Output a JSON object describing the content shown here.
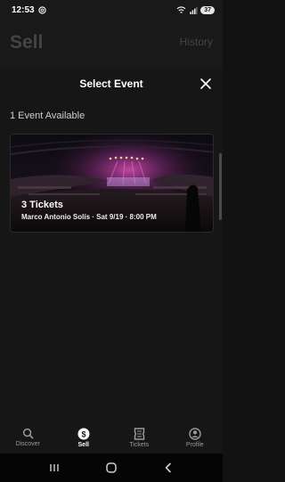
{
  "status": {
    "time": "12:53",
    "battery": "37"
  },
  "header": {
    "title": "Sell",
    "history_label": "History"
  },
  "sheet": {
    "title": "Select Event",
    "count_label": "1 Event Available"
  },
  "event": {
    "title": "3 Tickets",
    "subtitle": "Marco Antonio Solís · Sat 9/19 · 8:00 PM"
  },
  "tabs": [
    {
      "label": "Discover",
      "icon": "search-icon",
      "active": false
    },
    {
      "label": "Sell",
      "icon": "dollar-icon",
      "active": true
    },
    {
      "label": "Tickets",
      "icon": "ticket-icon",
      "active": false
    },
    {
      "label": "Profile",
      "icon": "profile-icon",
      "active": false
    }
  ],
  "colors": {
    "background": "#121212",
    "sheet": "#161616",
    "muted_header": "#444444"
  }
}
